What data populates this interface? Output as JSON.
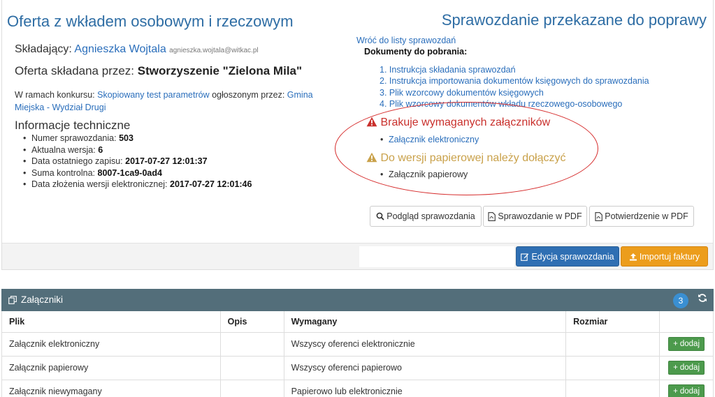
{
  "header": {
    "title": "Oferta z wkładem osobowym i rzeczowym",
    "status": "Sprawozdanie przekazane do poprawy"
  },
  "applicant": {
    "label": "Składający:",
    "name": "Agnieszka Wojtala",
    "email": "agnieszka.wojtala@witkac.pl"
  },
  "offer": {
    "label": "Oferta składana przez:",
    "org": "Stworzyszenie \"Zielona Mila\""
  },
  "contest": {
    "prefix": "W ramach konkursu:",
    "name": "Skopiowany test parametrów",
    "mid": "ogłoszonym przez:",
    "org": "Gmina Miejska - Wydział Drugi"
  },
  "tech": {
    "title": "Informacje techniczne",
    "items": [
      {
        "label": "Numer sprawozdania:",
        "value": "503"
      },
      {
        "label": "Aktualna wersja:",
        "value": "6"
      },
      {
        "label": "Data ostatniego zapisu:",
        "value": "2017-07-27 12:01:37"
      },
      {
        "label": "Suma kontrolna:",
        "value": "8007-1ca9-0ad4"
      },
      {
        "label": "Data złożenia wersji elektronicznej:",
        "value": "2017-07-27 12:01:46"
      }
    ]
  },
  "docs": {
    "back_link": "Wróć do listy sprawozdań",
    "title": "Dokumenty do pobrania:",
    "items": [
      "1. Instrukcja składania sprawozdań",
      "2. Instrukcja importowania dokumentów księgowych do sprawozdania",
      "3. Plik wzorcowy dokumentów księgowych",
      "4. Plik wzorcowy dokumentów wkładu rzeczowego-osobowego"
    ]
  },
  "warnings": {
    "missing_title": "Brakuje wymaganych załączników",
    "missing_item": "Załącznik elektroniczny",
    "paper_title": "Do wersji papierowej należy dołączyć",
    "paper_item": "Załącznik papierowy",
    "missing_color": "#c9302c",
    "paper_color": "#c9a14a"
  },
  "buttons": {
    "preview": "Podgląd sprawozdania",
    "pdf": "Sprawozdanie w PDF",
    "confirm": "Potwierdzenie w PDF",
    "edit": "Edycja sprawozdania",
    "import": "Importuj faktury"
  },
  "attachments": {
    "title": "Załączniki",
    "count": "3",
    "columns": [
      "Plik",
      "Opis",
      "Wymagany",
      "Rozmiar",
      ""
    ],
    "rows": [
      {
        "file": "Załącznik elektroniczny",
        "desc": "",
        "required": "Wszyscy oferenci elektronicznie",
        "size": "",
        "action": "dodaj"
      },
      {
        "file": "Załącznik papierowy",
        "desc": "",
        "required": "Wszyscy oferenci papierowo",
        "size": "",
        "action": "dodaj"
      },
      {
        "file": "Załącznik niewymagany",
        "desc": "",
        "required": "Papierowo lub elektronicznie",
        "size": "",
        "action": "dodaj"
      }
    ]
  }
}
